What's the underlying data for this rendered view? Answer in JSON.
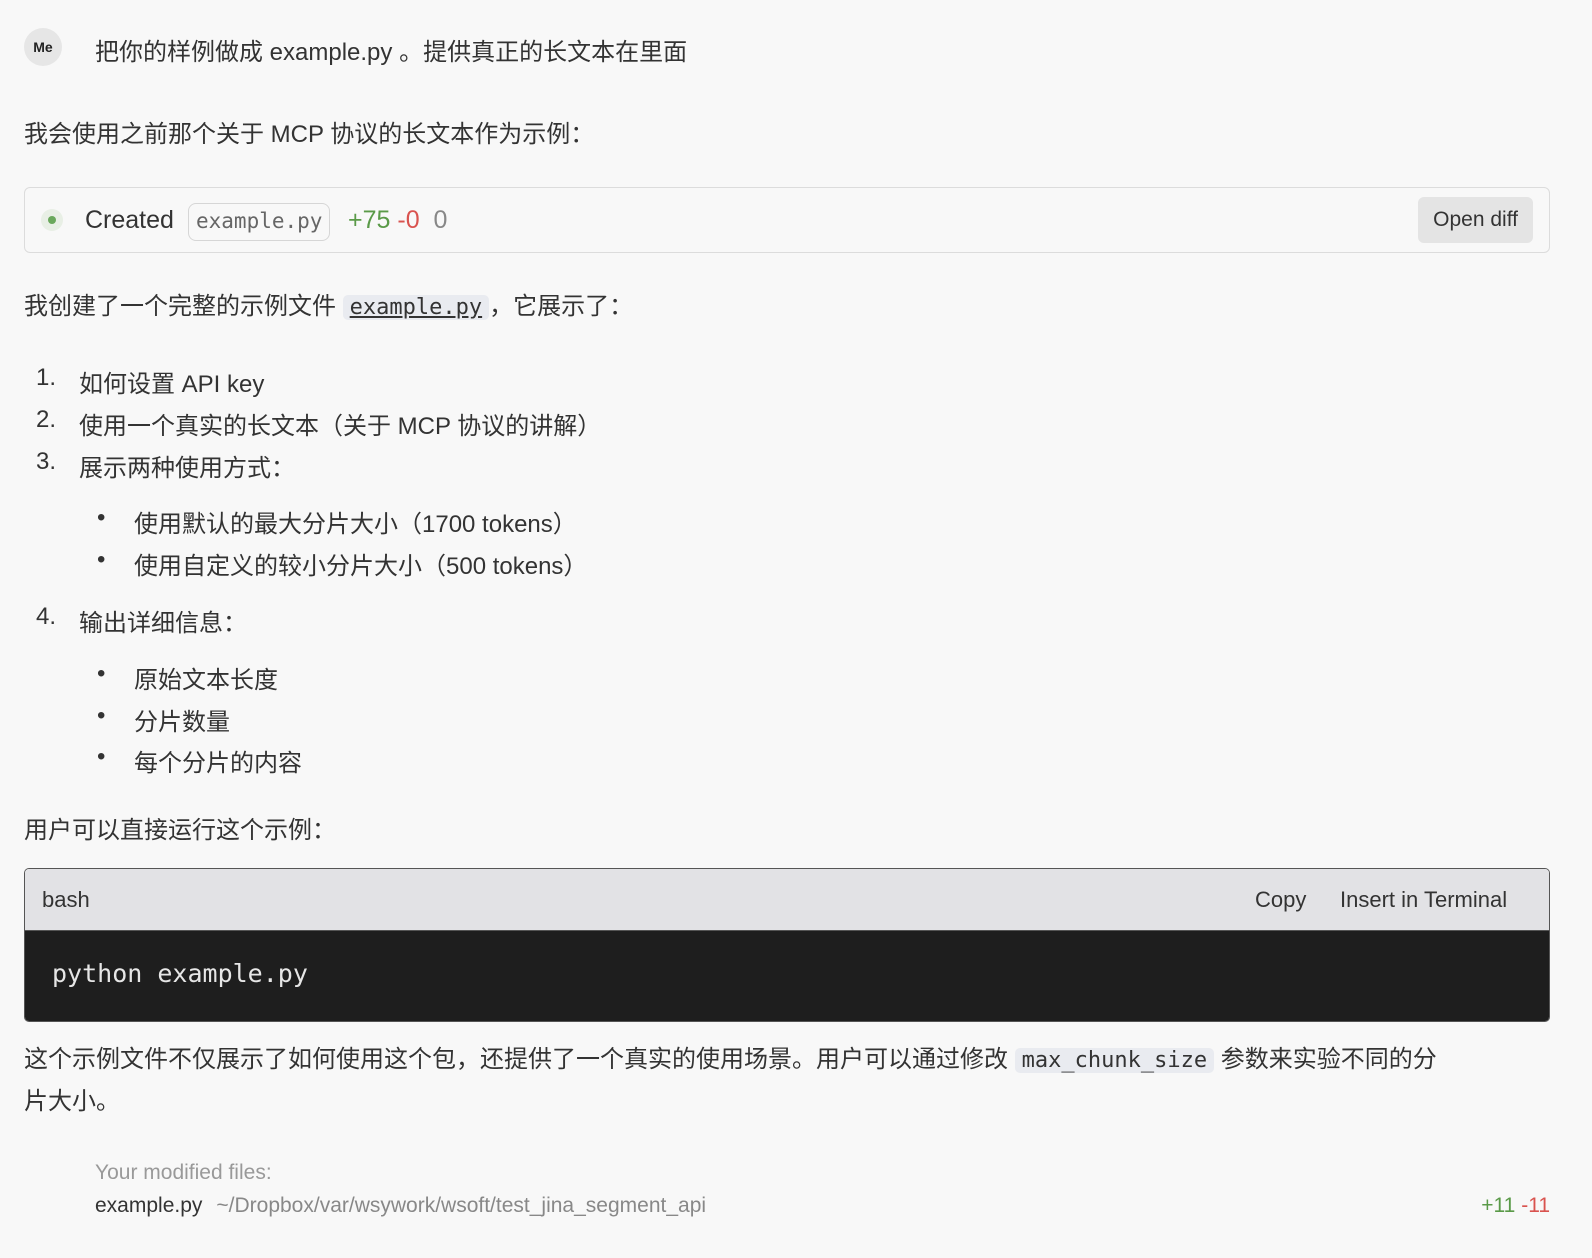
{
  "user_message": {
    "avatar": "Me",
    "text": "把你的样例做成 example.py 。提供真正的长文本在里面"
  },
  "intro": "我会使用之前那个关于 MCP 协议的长文本作为示例：",
  "created_card": {
    "label": "Created",
    "file": "example.py",
    "added": "+75",
    "removed": "-0",
    "other": "0",
    "open_diff": "Open diff",
    "status_color": "#6aa85c"
  },
  "summary": {
    "before": "我创建了一个完整的示例文件",
    "file": "example.py",
    "after": "，它展示了："
  },
  "list": [
    {
      "num": "1.",
      "text": "如何设置 API key"
    },
    {
      "num": "2.",
      "text": "使用一个真实的长文本（关于 MCP 协议的讲解）"
    },
    {
      "num": "3.",
      "text": "展示两种使用方式：",
      "sub": [
        "使用默认的最大分片大小（1700 tokens）",
        "使用自定义的较小分片大小（500 tokens）"
      ]
    },
    {
      "num": "4.",
      "text": "输出详细信息：",
      "sub": [
        "原始文本长度",
        "分片数量",
        "每个分片的内容"
      ]
    }
  ],
  "run_intro": "用户可以直接运行这个示例：",
  "code_block": {
    "lang": "bash",
    "copy": "Copy",
    "insert": "Insert in Terminal",
    "code": "python example.py"
  },
  "closing": {
    "before": "这个示例文件不仅展示了如何使用这个包，还提供了一个真实的使用场景。用户可以通过修改",
    "code": "max_chunk_size",
    "after": "参数来实验不同的分",
    "line2": "片大小。"
  },
  "footer": {
    "title": "Your modified files:",
    "file": "example.py",
    "path": "~/Dropbox/var/wsywork/wsoft/test_jina_segment_api",
    "added": "+11",
    "removed": "-11"
  }
}
